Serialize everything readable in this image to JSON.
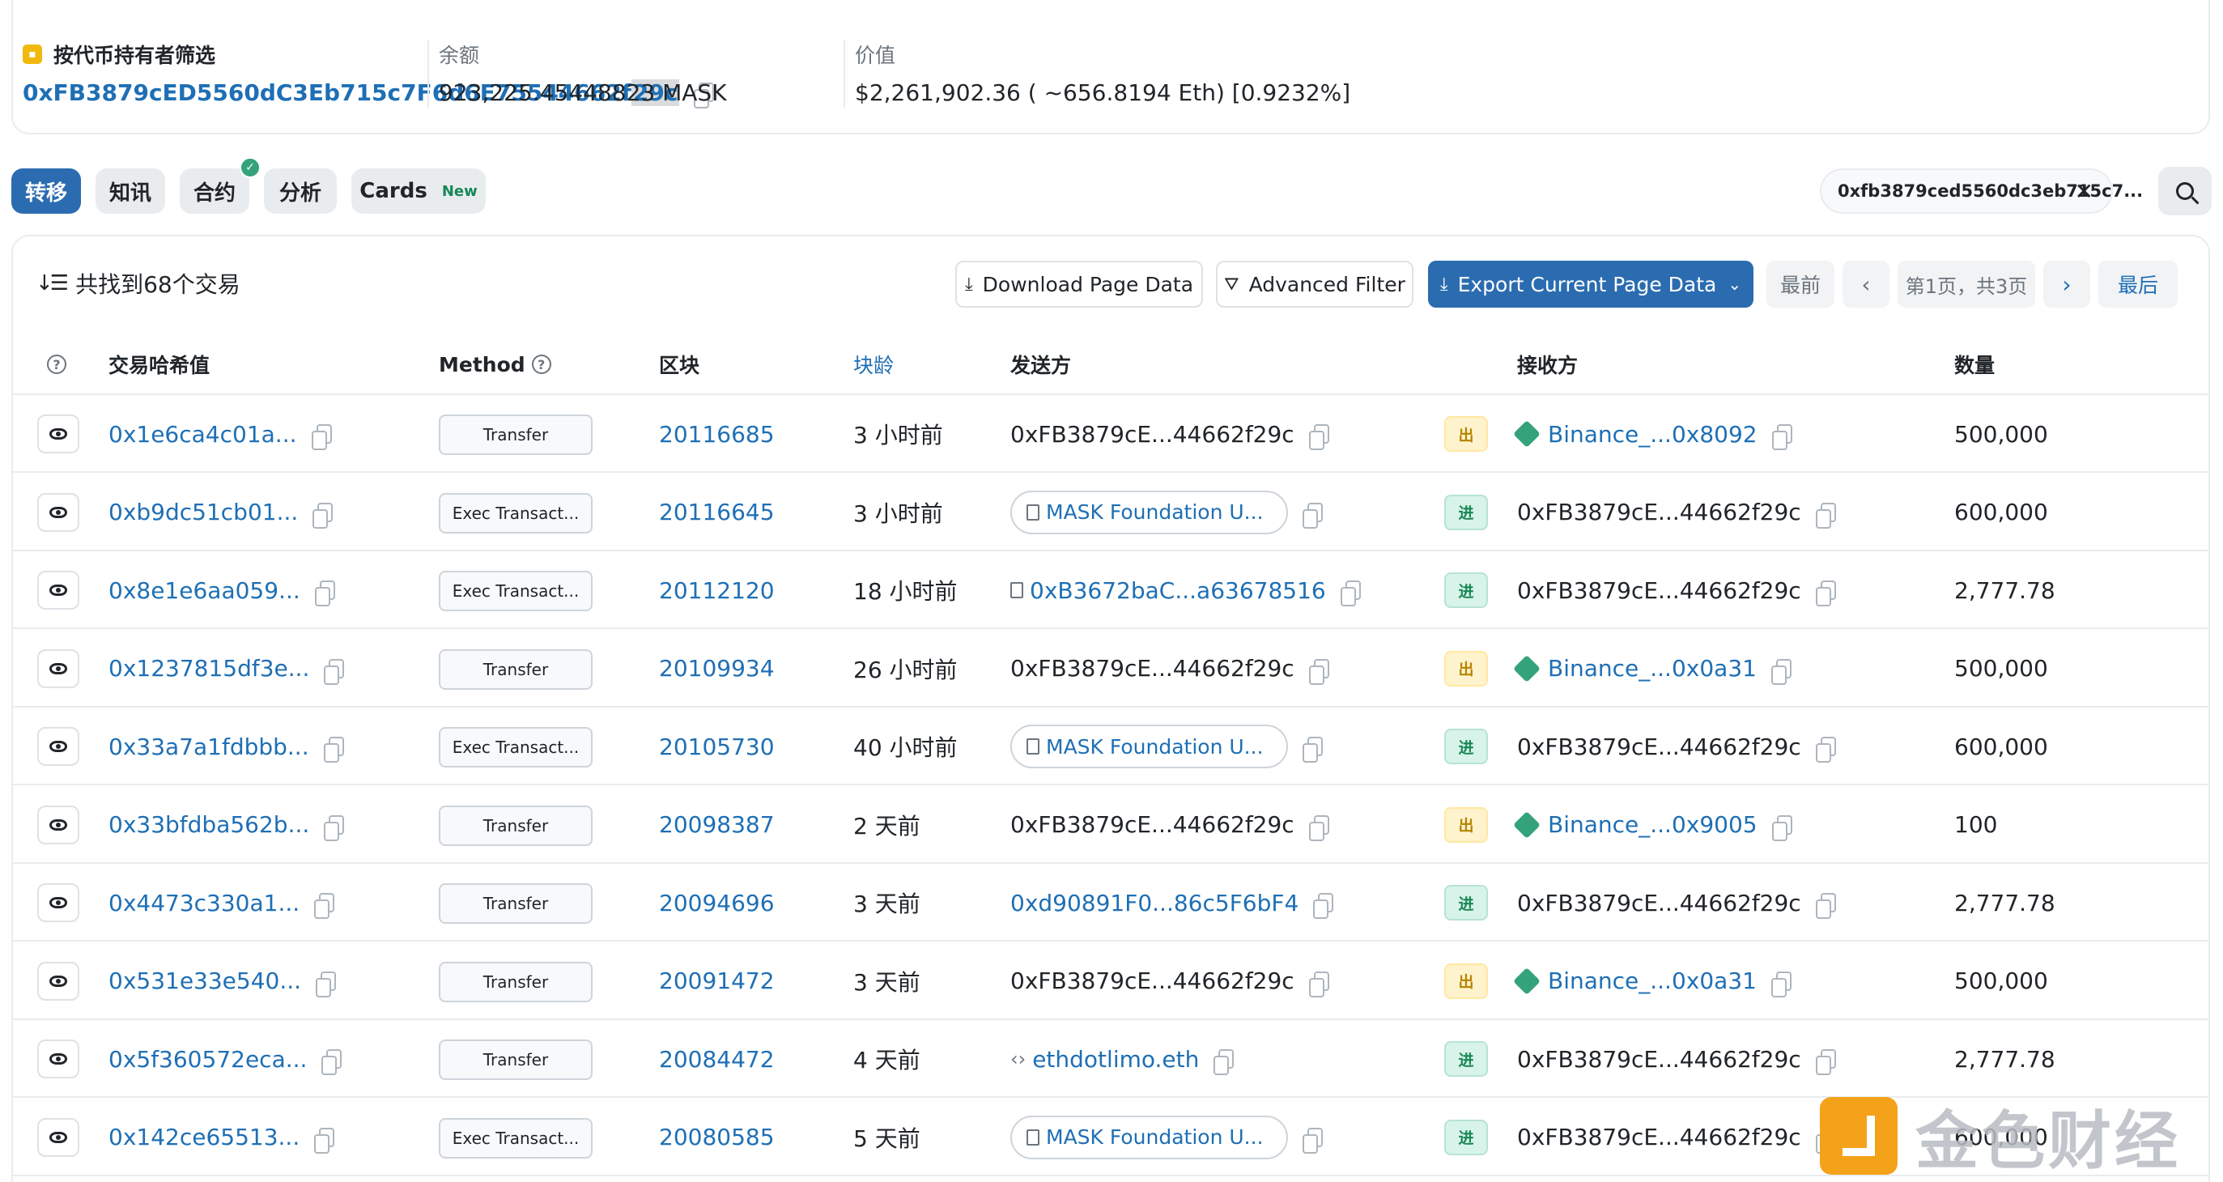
{
  "summary": {
    "filter_label": "按代币持有者筛选",
    "address_main": "0xFB3879cED5560dC3Eb715c7F6d6E75544662f",
    "address_tail": "29c",
    "balance_label": "余额",
    "balance_value": "923,225.45448823 MASK",
    "value_label": "价值",
    "value_value": "$2,261,902.36 ( ~656.8194 Eth) [0.9232%]"
  },
  "tabs": [
    {
      "label": "转移",
      "active": true
    },
    {
      "label": "知讯"
    },
    {
      "label": "合约",
      "badge": "✓"
    },
    {
      "label": "分析"
    },
    {
      "label": "Cards",
      "tag": "New"
    }
  ],
  "address_filter": "0xfb3879ced5560dc3eb715c7...",
  "toolbar": {
    "found": "共找到68个交易",
    "download": "Download Page Data",
    "advanced": "Advanced Filter",
    "export": "Export Current Page Data",
    "first": "最前",
    "page_info": "第1页，共3页",
    "last": "最后"
  },
  "columns": {
    "hash": "交易哈希值",
    "method": "Method",
    "block": "区块",
    "age": "块龄",
    "from": "发送方",
    "to": "接收方",
    "amount": "数量"
  },
  "rows": [
    {
      "hash": "0x1e6ca4c01a...",
      "method": "Transfer",
      "block": "20116685",
      "age": "3 小时前",
      "from": "0xFB3879cE...44662f29c",
      "from_type": "plain",
      "dir": "出",
      "to": "Binance_...0x8092",
      "to_type": "exchange",
      "amount": "500,000"
    },
    {
      "hash": "0xb9dc51cb01...",
      "method": "Exec Transact...",
      "block": "20116645",
      "age": "3 小时前",
      "from": "MASK Foundation U...",
      "from_type": "pill",
      "dir": "进",
      "to": "0xFB3879cE...44662f29c",
      "to_type": "plain",
      "amount": "600,000"
    },
    {
      "hash": "0x8e1e6aa059...",
      "method": "Exec Transact...",
      "block": "20112120",
      "age": "18 小时前",
      "from": "0xB3672baC...a63678516",
      "from_type": "contract",
      "dir": "进",
      "to": "0xFB3879cE...44662f29c",
      "to_type": "plain",
      "amount": "2,777.78"
    },
    {
      "hash": "0x1237815df3e...",
      "method": "Transfer",
      "block": "20109934",
      "age": "26 小时前",
      "from": "0xFB3879cE...44662f29c",
      "from_type": "plain",
      "dir": "出",
      "to": "Binance_...0x0a31",
      "to_type": "exchange",
      "amount": "500,000"
    },
    {
      "hash": "0x33a7a1fdbbb...",
      "method": "Exec Transact...",
      "block": "20105730",
      "age": "40 小时前",
      "from": "MASK Foundation U...",
      "from_type": "pill",
      "dir": "进",
      "to": "0xFB3879cE...44662f29c",
      "to_type": "plain",
      "amount": "600,000"
    },
    {
      "hash": "0x33bfdba562b...",
      "method": "Transfer",
      "block": "20098387",
      "age": "2 天前",
      "from": "0xFB3879cE...44662f29c",
      "from_type": "plain",
      "dir": "出",
      "to": "Binance_...0x9005",
      "to_type": "exchange",
      "amount": "100"
    },
    {
      "hash": "0x4473c330a1...",
      "method": "Transfer",
      "block": "20094696",
      "age": "3 天前",
      "from": "0xd90891F0...86c5F6bF4",
      "from_type": "link",
      "dir": "进",
      "to": "0xFB3879cE...44662f29c",
      "to_type": "plain",
      "amount": "2,777.78"
    },
    {
      "hash": "0x531e33e540...",
      "method": "Transfer",
      "block": "20091472",
      "age": "3 天前",
      "from": "0xFB3879cE...44662f29c",
      "from_type": "plain",
      "dir": "出",
      "to": "Binance_...0x0a31",
      "to_type": "exchange",
      "amount": "500,000"
    },
    {
      "hash": "0x5f360572eca...",
      "method": "Transfer",
      "block": "20084472",
      "age": "4 天前",
      "from": "ethdotlimo.eth",
      "from_type": "ens",
      "dir": "进",
      "to": "0xFB3879cE...44662f29c",
      "to_type": "plain",
      "amount": "2,777.78"
    },
    {
      "hash": "0x142ce65513...",
      "method": "Exec Transact...",
      "block": "20080585",
      "age": "5 天前",
      "from": "MASK Foundation U...",
      "from_type": "pill",
      "dir": "进",
      "to": "0xFB3879cE...44662f29c",
      "to_type": "plain",
      "amount": "600,000"
    }
  ],
  "watermark": "金色财经",
  "colors": {
    "link": "#1e6fb5",
    "primary": "#2b6cb0",
    "out_badge": "#fff3cd",
    "in_badge": "#d8f3e9",
    "exchange_icon": "#35a37a"
  }
}
